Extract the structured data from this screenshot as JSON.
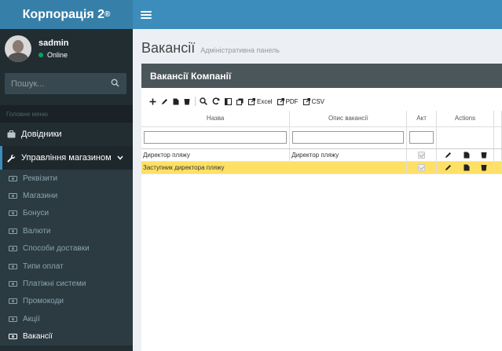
{
  "app": {
    "brand": "Корпорація 2",
    "brand_mark": "®"
  },
  "user": {
    "name": "sadmin",
    "status": "Online"
  },
  "search": {
    "placeholder": "Пошук..."
  },
  "sidebar": {
    "header": "Головне меню",
    "items": [
      {
        "label": "Довідники",
        "icon": "briefcase-icon"
      },
      {
        "label": "Управління магазином",
        "icon": "wrench-icon",
        "open": true
      }
    ],
    "sub_items": [
      {
        "label": "Реквізити"
      },
      {
        "label": "Магазини"
      },
      {
        "label": "Бонуси"
      },
      {
        "label": "Валюти"
      },
      {
        "label": "Способи доставки"
      },
      {
        "label": "Типи оплат"
      },
      {
        "label": "Платіжні системи"
      },
      {
        "label": "Промокоди"
      },
      {
        "label": "Акції"
      },
      {
        "label": "Вакансії",
        "active": true
      }
    ]
  },
  "page": {
    "title": "Вакансії",
    "subtitle": "Адміністративна панель"
  },
  "box": {
    "title": "Вакансії Компанії"
  },
  "toolbar": {
    "excel": "Excel",
    "pdf": "PDF",
    "csv": "CSV"
  },
  "table": {
    "columns": [
      "Назва",
      "Опис вакансії",
      "Акт",
      "Actions"
    ],
    "rows": [
      {
        "name": "Директор пляжу",
        "description": "Директор пляжу",
        "active": true,
        "selected": false
      },
      {
        "name": "Заступник директора пляжу",
        "description": "",
        "active": true,
        "selected": true
      }
    ]
  },
  "colors": {
    "brand": "#367fa9",
    "topbar": "#3c8dbc",
    "sidebar": "#222d32",
    "box_header": "#4b565b",
    "selected_row": "#ffe066"
  }
}
